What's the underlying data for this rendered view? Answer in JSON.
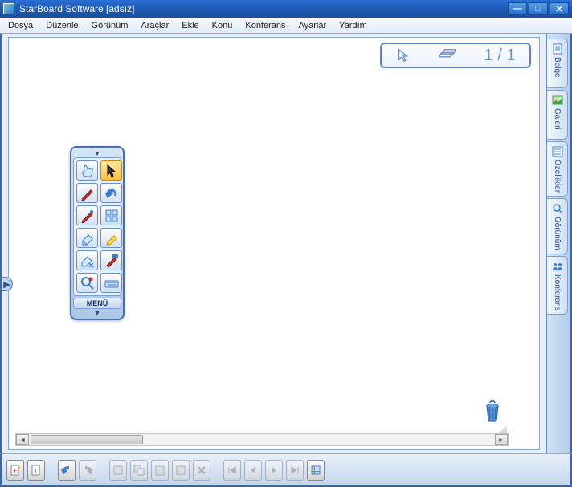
{
  "window": {
    "title": "StarBoard Software [adsız]"
  },
  "menubar": [
    "Dosya",
    "Düzenle",
    "Görünüm",
    "Araçlar",
    "Ekle",
    "Konu",
    "Konferans",
    "Ayarlar",
    "Yardım"
  ],
  "page_indicator": {
    "text": "1 / 1"
  },
  "toolbox": {
    "menu_label": "MENÜ",
    "tools": [
      {
        "name": "touch-tool",
        "selected": false
      },
      {
        "name": "cursor-tool",
        "selected": true
      },
      {
        "name": "pen-tool",
        "selected": false
      },
      {
        "name": "undo-tool",
        "selected": false
      },
      {
        "name": "pen2-tool",
        "selected": false
      },
      {
        "name": "panel-tool",
        "selected": false
      },
      {
        "name": "eraser-tool",
        "selected": false
      },
      {
        "name": "highlighter-tool",
        "selected": false
      },
      {
        "name": "erase-all-tool",
        "selected": false
      },
      {
        "name": "color-tool",
        "selected": false
      },
      {
        "name": "zoom-tool",
        "selected": false
      },
      {
        "name": "keyboard-tool",
        "selected": false
      }
    ]
  },
  "sidetabs": [
    {
      "name": "belge",
      "label": "Belge"
    },
    {
      "name": "galeri",
      "label": "Galeri"
    },
    {
      "name": "ozellikler",
      "label": "Özellikler"
    },
    {
      "name": "gorunum",
      "label": "Görünüm"
    },
    {
      "name": "konferans",
      "label": "Konferans"
    }
  ],
  "bottombar": [
    {
      "name": "new-page",
      "disabled": false
    },
    {
      "name": "page-thumb",
      "disabled": false
    },
    {
      "name": "undo",
      "disabled": false
    },
    {
      "name": "redo",
      "disabled": true
    },
    {
      "name": "cut",
      "disabled": true
    },
    {
      "name": "copy",
      "disabled": true
    },
    {
      "name": "paste",
      "disabled": true
    },
    {
      "name": "clone",
      "disabled": true
    },
    {
      "name": "delete",
      "disabled": true
    },
    {
      "name": "nav-first",
      "disabled": true
    },
    {
      "name": "nav-prev",
      "disabled": true
    },
    {
      "name": "nav-next",
      "disabled": true
    },
    {
      "name": "nav-last",
      "disabled": true
    },
    {
      "name": "grid",
      "disabled": false
    }
  ]
}
